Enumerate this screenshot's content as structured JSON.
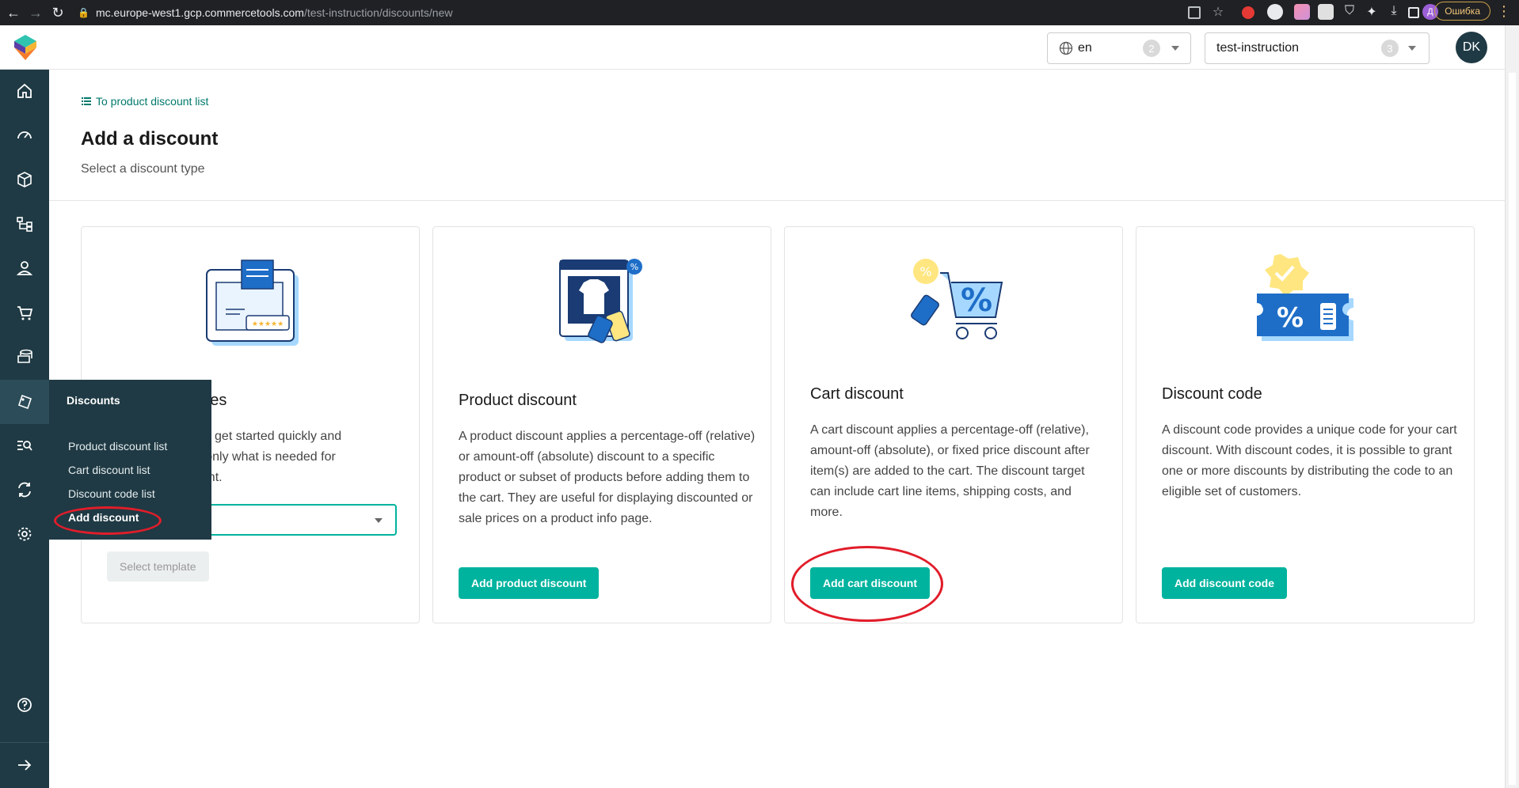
{
  "browser": {
    "url_host": "mc.europe-west1.gcp.commercetools.com",
    "url_path": "/test-instruction/discounts/new",
    "error_label": "Ошибка",
    "profile_initial": "Д"
  },
  "header": {
    "language": "en",
    "language_count": "2",
    "project": "test-instruction",
    "project_count": "3",
    "avatar_initials": "DK"
  },
  "nav": {
    "items": [
      "home-icon",
      "dashboard-icon",
      "products-icon",
      "categories-icon",
      "customers-icon",
      "orders-icon",
      "pricing-icon",
      "discounts-icon",
      "search-icon",
      "sync-icon",
      "settings-icon",
      "help-icon",
      "expand-icon"
    ]
  },
  "flyout": {
    "title": "Discounts",
    "items": [
      "Product discount list",
      "Cart discount list",
      "Discount code list",
      "Add discount"
    ]
  },
  "page": {
    "back_link": "To product discount list",
    "title": "Add a discount",
    "subtitle": "Select a discount type"
  },
  "cards": [
    {
      "title_visible": "plates",
      "desc_lines": [
        "you to get started quickly and",
        "ng only what is needed for",
        "count."
      ],
      "button": "Select template"
    },
    {
      "title": "Product discount",
      "desc": "A product discount applies a percentage-off (relative) or amount-off (absolute) discount to a specific product or subset of products before adding them to the cart. They are useful for displaying discounted or sale prices on a product info page.",
      "button": "Add product discount"
    },
    {
      "title": "Cart discount",
      "desc": "A cart discount applies a percentage-off (relative), amount-off (absolute), or fixed price discount after item(s) are added to the cart. The discount target can include cart line items, shipping costs, and more.",
      "button": "Add cart discount"
    },
    {
      "title": "Discount code",
      "desc": "A discount code provides a unique code for your cart discount. With discount codes, it is possible to grant one or more discounts by distributing the code to an eligible set of customers.",
      "button": "Add discount code"
    }
  ],
  "colors": {
    "accent": "#00b39e",
    "nav_bg": "#1f3a44",
    "annotation": "#e11d2a"
  }
}
